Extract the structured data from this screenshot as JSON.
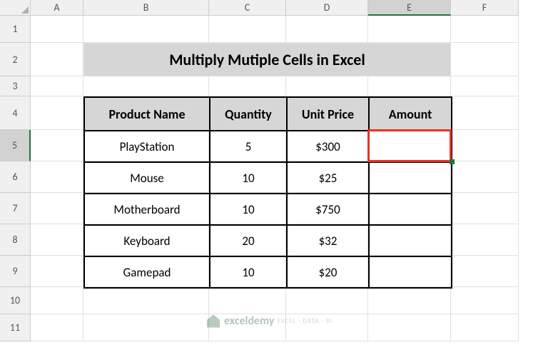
{
  "columns": {
    "A": "A",
    "B": "B",
    "C": "C",
    "D": "D",
    "E": "E",
    "F": "F"
  },
  "rows": {
    "1": "1",
    "2": "2",
    "3": "3",
    "4": "4",
    "5": "5",
    "6": "6",
    "7": "7",
    "8": "8",
    "9": "9",
    "10": "10",
    "11": "11"
  },
  "title": "Multiply Mutiple Cells in Excel",
  "headers": {
    "product": "Product Name",
    "quantity": "Quantity",
    "unitprice": "Unit Price",
    "amount": "Amount"
  },
  "data": [
    {
      "product": "PlayStation",
      "quantity": "5",
      "unitprice": "$300",
      "amount": ""
    },
    {
      "product": "Mouse",
      "quantity": "10",
      "unitprice": "$25",
      "amount": ""
    },
    {
      "product": "Motherboard",
      "quantity": "10",
      "unitprice": "$750",
      "amount": ""
    },
    {
      "product": "Keyboard",
      "quantity": "20",
      "unitprice": "$32",
      "amount": ""
    },
    {
      "product": "Gamepad",
      "quantity": "10",
      "unitprice": "$20",
      "amount": ""
    }
  ],
  "selected_cell": "E5",
  "watermark": {
    "brand": "exceldemy",
    "tagline": "EXCEL · DATA · BI"
  }
}
